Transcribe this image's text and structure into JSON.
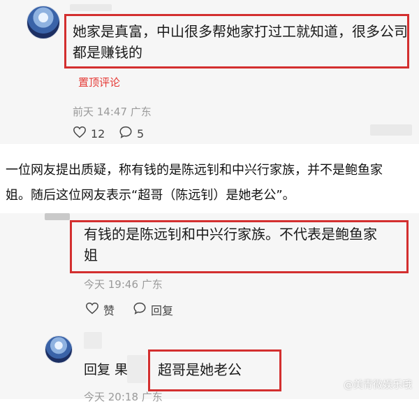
{
  "comment1": {
    "text_line1": "她家是真富，中山很多帮她家打过工就知道，很多公司",
    "text_line2": "都是赚钱的",
    "pin_label": "置顶评论",
    "time": "前天 14:47 广东",
    "likes": "12",
    "replies": "5"
  },
  "article": {
    "line1": "一位网友提出质疑，称有钱的是陈远钊和中兴行家族，并不是鲍鱼家",
    "line2": "姐。随后这位网友表示“超哥（陈远钊）是她老公”。"
  },
  "comment2": {
    "text_line1": "有钱的是陈远钊和中兴行家族。不代表是鲍鱼家",
    "text_line2": "姐",
    "time": "今天 19:46 广东",
    "like_label": "赞",
    "reply_label": "回复"
  },
  "reply": {
    "prefix": "回复 果",
    "text": "超哥是她老公",
    "time": "今天 20:18 广东"
  },
  "watermark": "@美青微娱乐哦",
  "icons": {
    "heart": "heart-icon",
    "comment": "comment-bubble-icon"
  },
  "colors": {
    "highlight_border": "#d32f2f",
    "pin_text": "#e53935",
    "meta_text": "#9a9a9a"
  }
}
